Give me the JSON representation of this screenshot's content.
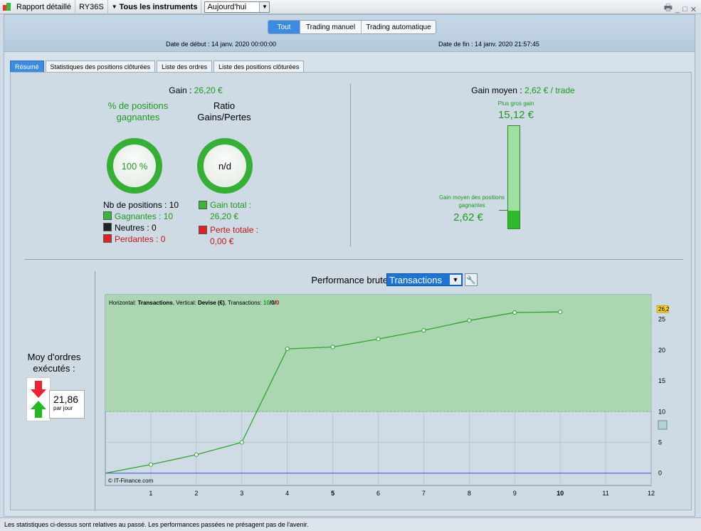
{
  "toolbar": {
    "report_label": "Rapport détaillé",
    "account": "RY36S",
    "instruments_label": "Tous les instruments",
    "period": "Aujourd'hui"
  },
  "filters": {
    "all": "Tout",
    "manual": "Trading manuel",
    "auto": "Trading automatique"
  },
  "dates": {
    "start": "Date de début : 14 janv. 2020 00:00:00",
    "end": "Date de fin : 14 janv. 2020 21:57:45"
  },
  "tabs": [
    "Résumé",
    "Statistiques des positions clôturées",
    "Liste des ordres",
    "Liste des positions clôturées"
  ],
  "summary": {
    "gain_label": "Gain : ",
    "gain_value": "26,20 €",
    "win_pct_title": "% de positions gagnantes",
    "win_pct_value": "100 %",
    "ratio_title": "Ratio Gains/Pertes",
    "ratio_value": "n/d",
    "nb_positions": "Nb de positions : 10",
    "winners": "Gagnantes : 10",
    "neutral": "Neutres : 0",
    "losers": "Perdantes : 0",
    "total_gain": "Gain total : 26,20 €",
    "total_loss": "Perte totale : 0,00 €"
  },
  "avg_gain": {
    "label": "Gain moyen : ",
    "value": "2,62 € / trade",
    "biggest_label": "Plus gros gain",
    "biggest_value": "15,12 €",
    "avg_winners_label": "Gain moyen des positions gagnantes",
    "avg_winners_value": "2,62 €",
    "avg_fraction": 0.173
  },
  "orders": {
    "title": "Moy d'ordres exécutés :",
    "value": "21,86",
    "unit": "par jour"
  },
  "perf": {
    "title": "Performance brute",
    "select": "Transactions"
  },
  "chart_data": {
    "type": "line",
    "header_prefix": "Horizontal: ",
    "header_h": "Transactions",
    "header_mid": ", Vertical: ",
    "header_v": "Devise (€)",
    "header_suffix": ", Transactions: ",
    "header_counts": [
      "10",
      "/",
      "0",
      "/",
      "0"
    ],
    "copyright": "© IT-Finance.com",
    "x_ticks": [
      "1",
      "2",
      "3",
      "4",
      "5",
      "6",
      "7",
      "8",
      "9",
      "10",
      "11",
      "12"
    ],
    "y_ticks": [
      "0",
      "5",
      "10",
      "15",
      "20",
      "25"
    ],
    "xlim": [
      0,
      12
    ],
    "ylim": [
      -2,
      29
    ],
    "last_value_label": "26,2",
    "series": [
      {
        "x": [
          0,
          1,
          2,
          3,
          4,
          5,
          6,
          7,
          8,
          9,
          10
        ],
        "values": [
          0,
          1.4,
          3.0,
          5.0,
          20.2,
          20.5,
          21.8,
          23.2,
          24.8,
          26.1,
          26.2
        ]
      }
    ],
    "colors": {
      "line": "#2ea52e",
      "fill": "#a8d6ae",
      "zero": "#3a4fd8"
    }
  }
}
